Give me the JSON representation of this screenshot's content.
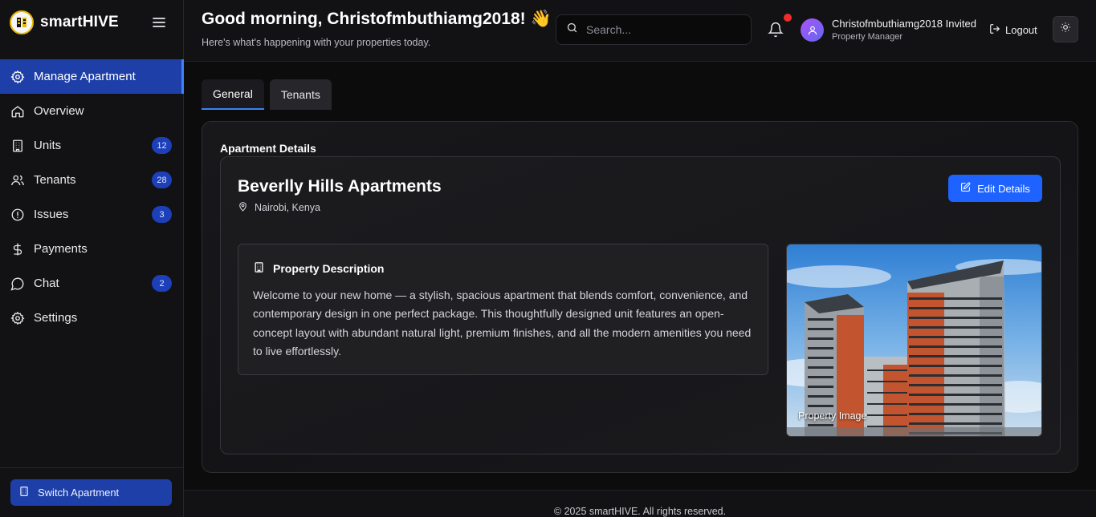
{
  "brand": {
    "name": "smartHIVE"
  },
  "sidebar": {
    "items": [
      {
        "label": "Manage Apartment",
        "icon": "gear-icon",
        "active": true,
        "badge": ""
      },
      {
        "label": "Overview",
        "icon": "home-icon",
        "active": false,
        "badge": ""
      },
      {
        "label": "Units",
        "icon": "building-icon",
        "active": false,
        "badge": "12"
      },
      {
        "label": "Tenants",
        "icon": "users-icon",
        "active": false,
        "badge": "28"
      },
      {
        "label": "Issues",
        "icon": "alert-circle-icon",
        "active": false,
        "badge": "3"
      },
      {
        "label": "Payments",
        "icon": "dollar-icon",
        "active": false,
        "badge": ""
      },
      {
        "label": "Chat",
        "icon": "chat-bubble-icon",
        "active": false,
        "badge": "2"
      },
      {
        "label": "Settings",
        "icon": "gear-icon",
        "active": false,
        "badge": ""
      }
    ],
    "switch_label": "Switch Apartment"
  },
  "header": {
    "greeting": "Good morning, Christofmbuthiamg2018! 👋",
    "subgreeting": "Here's what's happening with your properties today.",
    "search_placeholder": "Search...",
    "user_name": "Christofmbuthiamg2018 Invited",
    "user_role": "Property Manager",
    "logout_label": "Logout"
  },
  "main": {
    "tabs": [
      {
        "label": "General",
        "active": true
      },
      {
        "label": "Tenants",
        "active": false
      }
    ],
    "section_title": "Apartment Details",
    "apartment": {
      "name": "Beverlly Hills Apartments",
      "location": "Nairobi, Kenya",
      "edit_label": "Edit Details",
      "description_title": "Property Description",
      "description": "Welcome to your new home — a stylish, spacious apartment that blends comfort, convenience, and contemporary design in one perfect package. This thoughtfully designed unit features an open-concept layout with abundant natural light, premium finishes, and all the modern amenities you need to live effortlessly.",
      "image_label": "Property Image"
    }
  },
  "footer": {
    "text": "© 2025 smartHIVE. All rights reserved."
  },
  "colors": {
    "accent": "#1e63ff",
    "active_nav": "#1e3fa8",
    "badge": "#1d3fb8",
    "notification_dot": "#ef2b2b"
  }
}
